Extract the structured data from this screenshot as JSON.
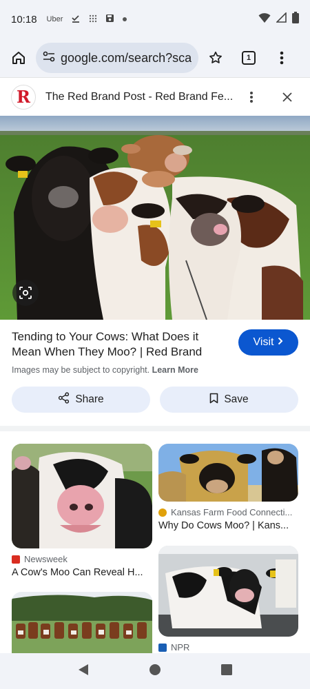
{
  "status_bar": {
    "time": "10:18",
    "uber_label": "Uber"
  },
  "browser": {
    "url": "google.com/search?sca_",
    "tab_count": "1"
  },
  "result": {
    "site_logo_letter": "R",
    "site_title": "The Red Brand Post - Red Brand Fe...",
    "headline": "Tending to Your Cows: What Does it Mean When They Moo? | Red Brand",
    "visit_label": "Visit",
    "copyright_text": "Images may be subject to copyright.",
    "learn_more": "Learn More",
    "share_label": "Share",
    "save_label": "Save"
  },
  "related": [
    {
      "source": "Newsweek",
      "title": "A Cow's Moo Can Reveal H...",
      "source_color": "#d92d20"
    },
    {
      "source": "Kansas Farm Food Connecti...",
      "title": "Why Do Cows Moo? | Kans...",
      "source_color": "#e0a10b"
    },
    {
      "source": "NPR",
      "title": "",
      "source_color": "#1a5fb4"
    }
  ],
  "colors": {
    "accent": "#0b57d0",
    "chrome": "#f1f3f8",
    "action_bg": "#e8eefa"
  }
}
